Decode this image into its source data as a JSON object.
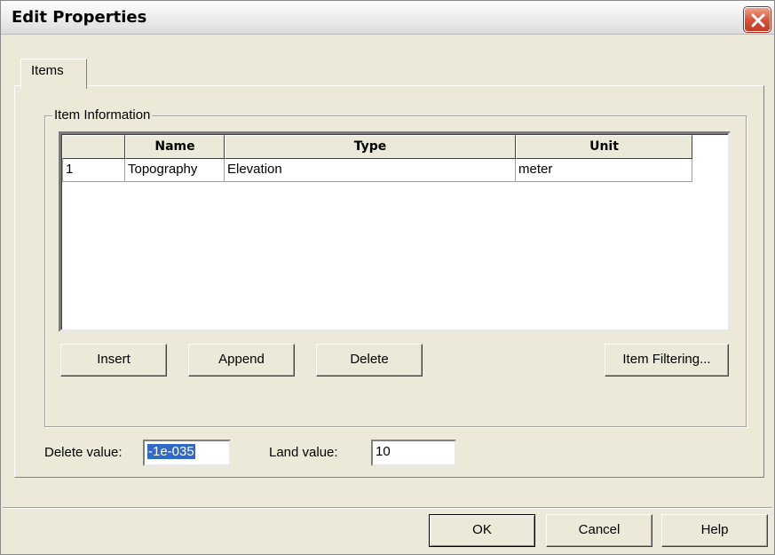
{
  "window": {
    "title": "Edit Properties",
    "close_icon": "close-icon"
  },
  "tabs": [
    {
      "label": "Items",
      "selected": true
    }
  ],
  "group": {
    "label": "Item Information",
    "columns": [
      "",
      "Name",
      "Type",
      "Unit"
    ],
    "rows": [
      {
        "index": "1",
        "name": "Topography",
        "type": "Elevation",
        "unit": "meter"
      }
    ],
    "buttons": {
      "insert": "Insert",
      "append": "Append",
      "delete": "Delete",
      "filtering": "Item Filtering..."
    }
  },
  "fields": {
    "delete_value_label": "Delete value:",
    "delete_value": "-1e-035",
    "land_value_label": "Land value:",
    "land_value": "10"
  },
  "footer": {
    "ok": "OK",
    "cancel": "Cancel",
    "help": "Help"
  },
  "colors": {
    "dialog_bg": "#ece9d8",
    "close_button": "#d8543a",
    "selection": "#316ac5"
  }
}
